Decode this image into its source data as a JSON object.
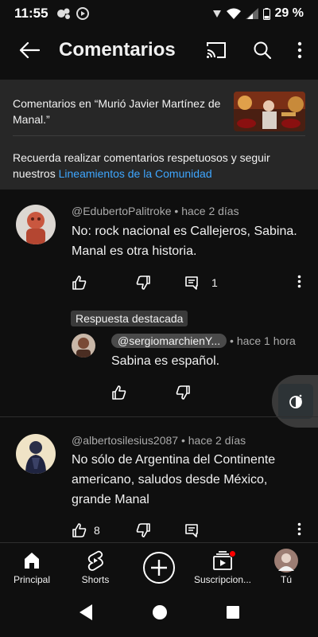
{
  "status": {
    "time": "11:55",
    "battery": "29 %"
  },
  "app_bar": {
    "title": "Comentarios"
  },
  "context": {
    "video_text": "Comentarios en “Murió Javier Martínez de Manal.”",
    "guidelines_prefix": "Recuerda realizar comentarios respetuosos y seguir nuestros ",
    "guidelines_link": "Lineamientos de la Comunidad"
  },
  "comments": [
    {
      "handle": "@EdubertoPalitroke",
      "time": "hace 2 días",
      "body": "No: rock nacional es Callejeros, Sabina. Manal es otra historia.",
      "likes": "",
      "replies": "1"
    },
    {
      "handle": "@albertosilesius2087",
      "time": "hace 2 días",
      "body": "No sólo de Argentina del Continente americano, saludos desde México, grande Manal",
      "likes": "8",
      "replies": ""
    }
  ],
  "reply": {
    "badge": "Respuesta destacada",
    "handle": "@sergiomarchienY...",
    "time": "hace 1 hora",
    "body": "Sabina es español."
  },
  "separator": "•",
  "bottom_nav": [
    {
      "label": "Principal"
    },
    {
      "label": "Shorts"
    },
    {
      "label": ""
    },
    {
      "label": "Suscripcion..."
    },
    {
      "label": "Tú"
    }
  ],
  "colors": {
    "background": "#0f0f0f",
    "panel": "#272727",
    "link": "#3ea6ff",
    "notification": "#ff0000"
  }
}
